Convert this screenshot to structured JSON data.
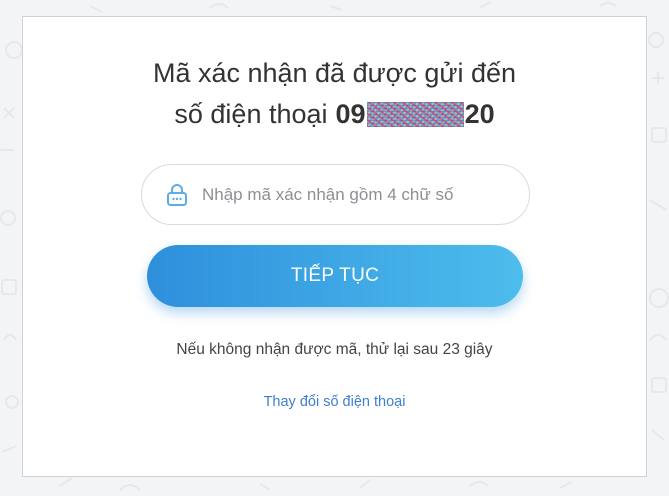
{
  "heading": {
    "line1": "Mã xác nhận đã được gửi đến",
    "line2_prefix": "số điện thoại",
    "phone_start": "09",
    "phone_end": "20"
  },
  "code_input": {
    "placeholder": "Nhập mã xác nhận gồm 4 chữ số",
    "value": "",
    "icon": "lock-icon"
  },
  "continue_button": {
    "label": "TIẾP TỤC"
  },
  "resend_notice": "Nếu không nhận được mã, thử lại sau 23 giây",
  "change_phone_link": "Thay đổi số điện thoại",
  "colors": {
    "page_background": "#f3f4f5",
    "card_background": "#ffffff",
    "button_gradient_start": "#2e8fdc",
    "button_gradient_end": "#4dbdec",
    "link": "#3f7fcf",
    "lock_icon": "#5aaee6"
  }
}
